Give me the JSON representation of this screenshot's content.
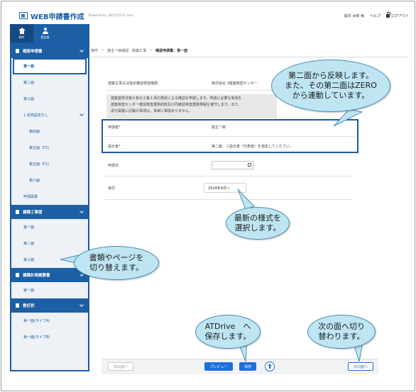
{
  "header": {
    "app_title": "WEB申請書作成",
    "powered_by": "Powered by 3Dカタログ.com",
    "user_name": "堤井 太郎 様",
    "help": "ヘルプ",
    "logout": "ログアウト"
  },
  "topnav": {
    "items": [
      {
        "label": "物件",
        "icon": "home-icon"
      },
      {
        "label": "設定者",
        "icon": "user-icon"
      }
    ]
  },
  "sidebar": {
    "sections": [
      {
        "title": "確認申請書",
        "items": [
          {
            "label": "第一面"
          },
          {
            "label": "第二面"
          },
          {
            "label": "第三面"
          },
          {
            "label": "1.名称設定なし"
          },
          {
            "label": "第四面"
          },
          {
            "label": "第五面（F2)"
          },
          {
            "label": "第五面（F1)"
          },
          {
            "label": "第六面"
          },
          {
            "label": "申請図書"
          }
        ]
      },
      {
        "title": "建築工事届",
        "items": [
          {
            "label": "第一面"
          },
          {
            "label": "第二面"
          },
          {
            "label": "第三面"
          }
        ]
      },
      {
        "title": "建築計画概要書",
        "items": [
          {
            "label": "第一面"
          }
        ]
      },
      {
        "title": "委任状",
        "items": [
          {
            "label": "第一面(タイプA)"
          },
          {
            "label": "第一面(タイプB)"
          }
        ]
      }
    ]
  },
  "breadcrumb": [
    "物件",
    "施主一郎様邸　新築工事",
    "確認申請書：第一面"
  ],
  "main": {
    "authority_label": "建築主事又は指定確認検査機関",
    "authority_value": "株式会社 3建築検査センター",
    "notice": "建築基準法第６条の２第１項の規定による確認を申請します。申請に必要な事項を\n建築検査センター確認検査業務約款及び同確認検査業務規程を遵守します。また、\n添付図書に記載の事項は、事実に相違ありません。",
    "applicant_label": "申請者*",
    "applicant_value": "施主一郎",
    "designer_label": "設計者*",
    "designer_value": "第二面　３設計者（代表者）を指定してください。",
    "date_label": "申請日",
    "style_label": "様式",
    "style_value": "2024年4月〜"
  },
  "bottom": {
    "prev": "前の面へ",
    "preview": "プレビュー",
    "save": "保存",
    "next": "次の面へ"
  },
  "callouts": {
    "reflect": "第二面から反映します。\nまた、その第二面はZERO\nから連動しています。",
    "latest_style": "最新の様式を\n選択します。",
    "switch_docs": "書類やページを\n切り替えます。",
    "atdrive": "ATDrive　へ\n保存します。",
    "next_page": "次の面へ切り\n替わります。"
  }
}
